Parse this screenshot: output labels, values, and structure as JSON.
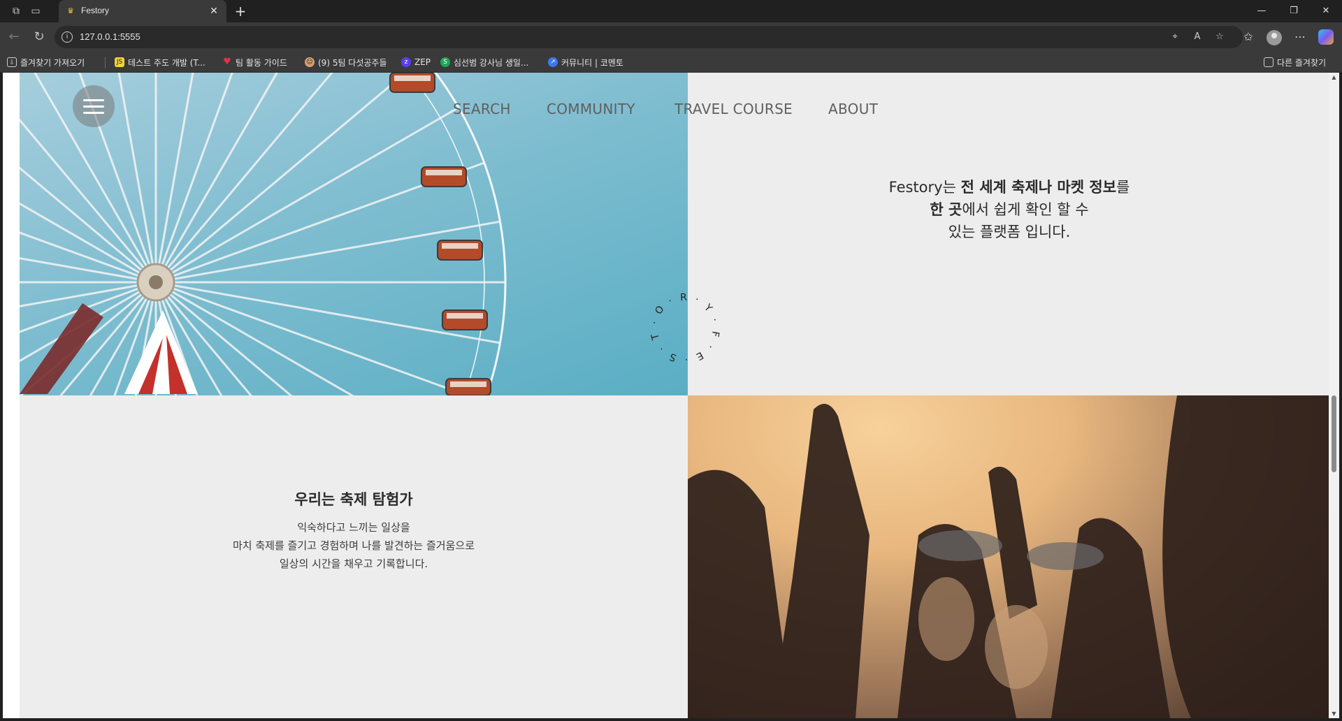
{
  "browser": {
    "tab_title": "Festory",
    "url": "127.0.0.1:5555",
    "bookmarks": [
      {
        "label": "즐겨찾기 가져오기",
        "icon": "import-icon",
        "color": "#3a3a3a"
      },
      {
        "label": "테스트 주도 개발 (T...",
        "icon": "js-icon",
        "color": "#f0d33a"
      },
      {
        "label": "팀 활동 가이드",
        "icon": "heart-icon",
        "color": "#e0314a"
      },
      {
        "label": "(9) 5팀 다섯공주들",
        "icon": "face-icon",
        "color": "#d8a070"
      },
      {
        "label": "ZEP",
        "icon": "zep-icon",
        "color": "#5a3ff0"
      },
      {
        "label": "심선범 강사님 생일...",
        "icon": "s-icon",
        "color": "#1aa85a"
      },
      {
        "label": "커뮤니티 | 코멘토",
        "icon": "comento-icon",
        "color": "#3a7af0"
      }
    ],
    "other_bookmarks": "다른 즐겨찾기"
  },
  "site": {
    "nav": [
      "SEARCH",
      "COMMUNITY",
      "TRAVEL COURSE",
      "ABOUT"
    ],
    "intro": {
      "brand": "Festory",
      "part1": "는 ",
      "bold1": "전 세계 축제나 마켓 정보",
      "part2": "를",
      "bold2": "한 곳",
      "part3": "에서 쉽게 확인 할 수",
      "line3": "있는 플랫폼 입니다."
    },
    "explorer": {
      "title": "우리는 축제 탐험가",
      "lines": [
        "익숙하다고 느끼는 일상을",
        "마치 축제를 즐기고 경험하며 나를 발견하는 즐거움으로",
        "일상의 시간을 채우고 기록합니다."
      ]
    },
    "circle_text": [
      "F",
      "E",
      "S",
      "T",
      "O",
      "R",
      "Y"
    ]
  },
  "colors": {
    "panel_bg": "#ededed",
    "text_dark": "#2a2a2a",
    "nav_text": "#5f5f5f"
  }
}
